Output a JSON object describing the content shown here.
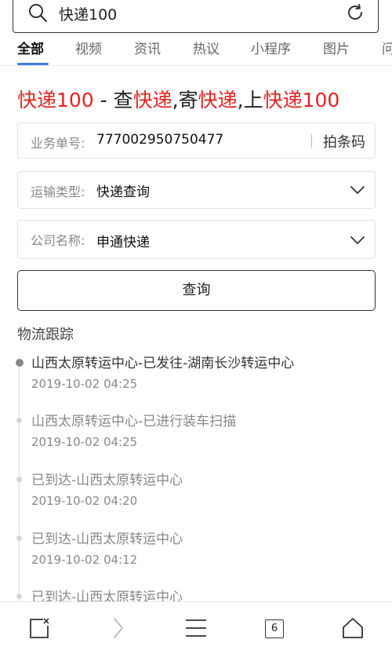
{
  "search": {
    "query": "快递100"
  },
  "tabs": [
    "全部",
    "视频",
    "资讯",
    "热议",
    "小程序",
    "图片",
    "问"
  ],
  "heading": {
    "p1": "快递100",
    "p2": " - 查",
    "p3": "快递",
    "p4": ",寄",
    "p5": "快递",
    "p6": ",上",
    "p7": "快递100"
  },
  "form": {
    "tracking_label": "业务单号:",
    "tracking_value": "777002950750477",
    "barcode_label": "拍条码",
    "type_label": "运输类型:",
    "type_value": "快递查询",
    "company_label": "公司名称:",
    "company_value": "申通快递",
    "query_label": "查询"
  },
  "tracking": {
    "title": "物流跟踪",
    "events": [
      {
        "text": "山西太原转运中心-已发往-湖南长沙转运中心",
        "time": "2019-10-02 04:25"
      },
      {
        "text": "山西太原转运中心-已进行装车扫描",
        "time": "2019-10-02 04:25"
      },
      {
        "text": "已到达-山西太原转运中心",
        "time": "2019-10-02 04:20"
      },
      {
        "text": "已到达-山西太原转运中心",
        "time": "2019-10-02 04:12"
      },
      {
        "text": "已到达-山西太原转运中心",
        "time": ""
      }
    ]
  },
  "bottom_bar": {
    "tab_count": "6"
  },
  "colors": {
    "accent": "#3f7be8",
    "brand_red": "#e52323"
  }
}
